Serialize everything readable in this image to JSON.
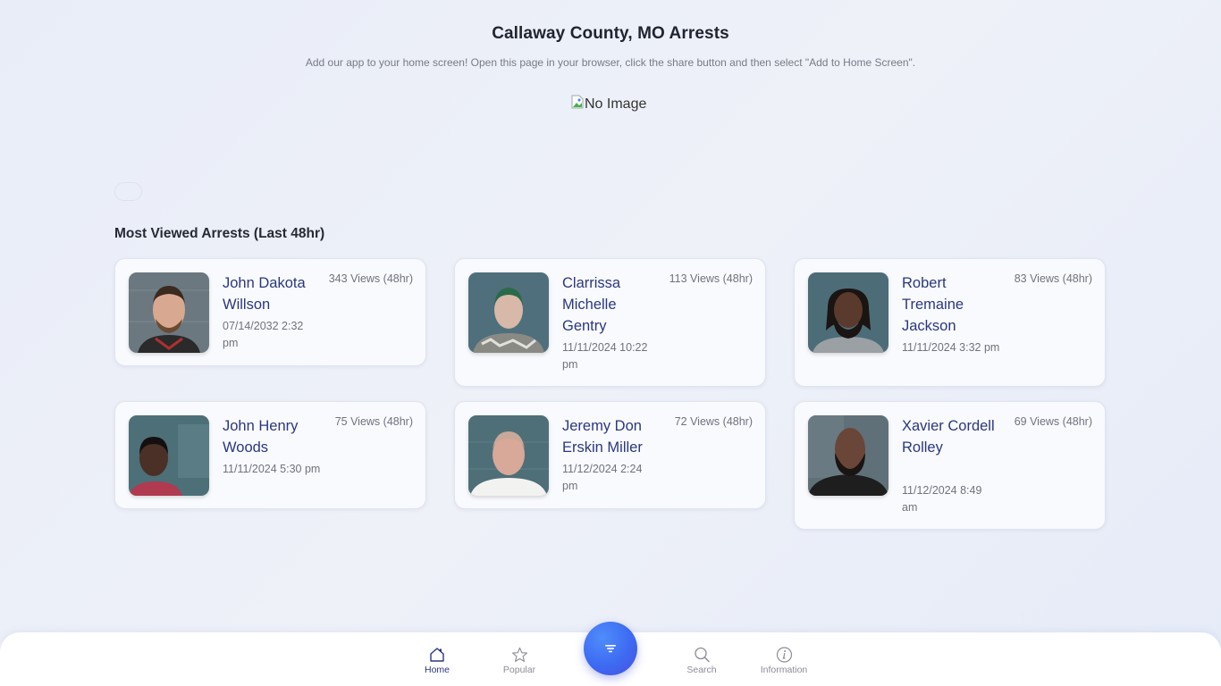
{
  "header": {
    "title": "Callaway County, MO Arrests",
    "subtitle": "Add our app to your home screen! Open this page in your browser, click the share button and then select \"Add to Home Screen\".",
    "banner_alt": "No Image"
  },
  "section": {
    "title": "Most Viewed Arrests (Last 48hr)"
  },
  "arrests": [
    {
      "name": "John Dakota Willson",
      "date": "07/14/2032 2:32 pm",
      "views": "343 Views (48hr)"
    },
    {
      "name": "Clarrissa Michelle Gentry",
      "date": "11/11/2024 10:22 pm",
      "views": "113 Views (48hr)"
    },
    {
      "name": "Robert Tremaine Jackson",
      "date": "11/11/2024 3:32 pm",
      "views": "83 Views (48hr)"
    },
    {
      "name": "John Henry Woods",
      "date": "11/11/2024 5:30 pm",
      "views": "75 Views (48hr)"
    },
    {
      "name": "Jeremy Don Erskin Miller",
      "date": "11/12/2024 2:24 pm",
      "views": "72 Views (48hr)"
    },
    {
      "name": "Xavier Cordell Rolley",
      "date": "11/12/2024 8:49 am",
      "views": "69 Views (48hr)"
    }
  ],
  "nav": {
    "items": [
      {
        "label": "Home",
        "icon": "home-icon",
        "active": true
      },
      {
        "label": "Popular",
        "icon": "star-icon",
        "active": false
      },
      {
        "label": "Search",
        "icon": "search-icon",
        "active": false
      },
      {
        "label": "Information",
        "icon": "info-icon",
        "active": false
      }
    ],
    "fab_icon": "filter-icon"
  },
  "colors": {
    "accent": "#3d6af2",
    "name_text": "#2a3780",
    "muted_text": "#6f7280"
  }
}
